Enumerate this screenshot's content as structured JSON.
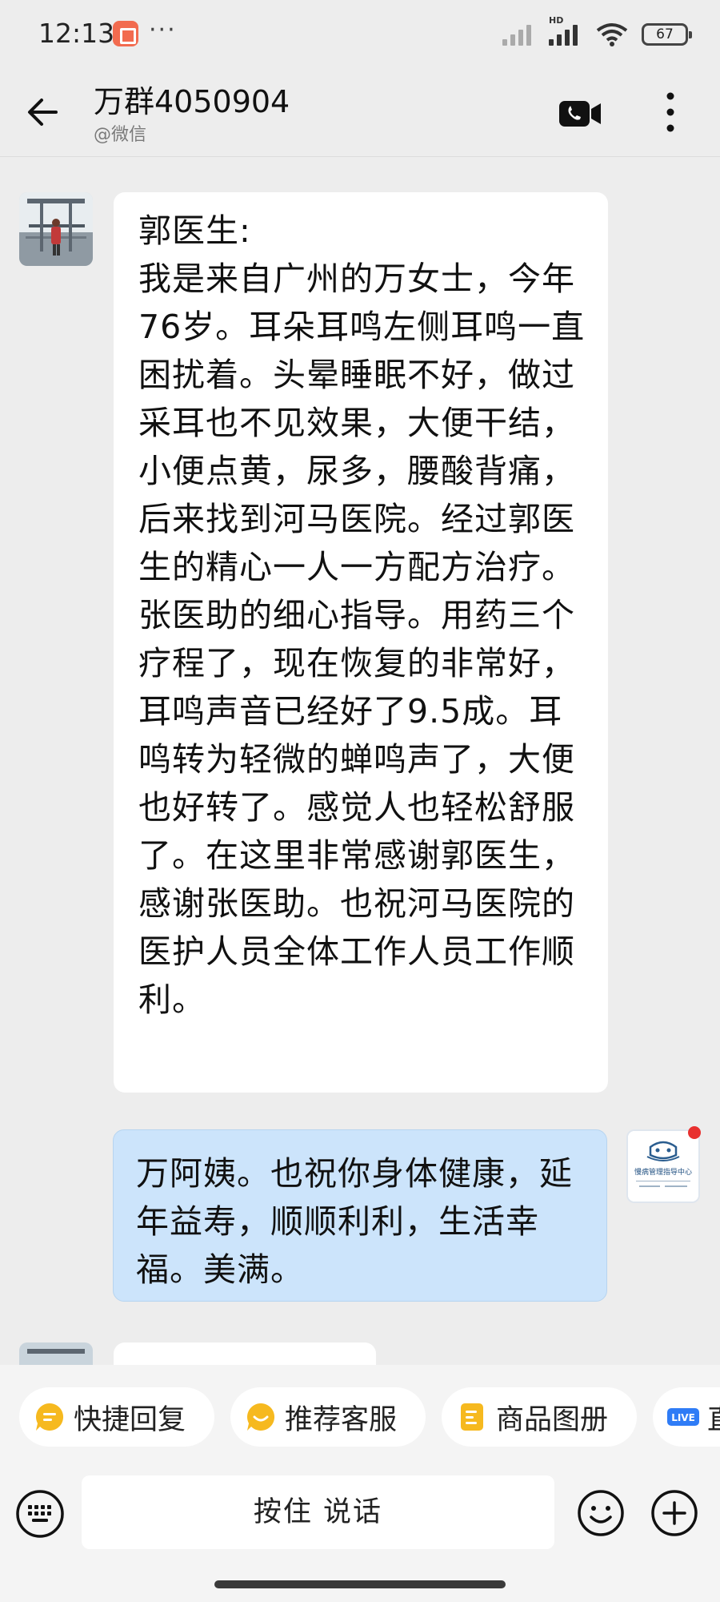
{
  "status_bar": {
    "time": "12:13",
    "more": "···",
    "network_label": "HD",
    "battery": "67",
    "notification_color": "#f26b4f"
  },
  "header": {
    "title": "万群4050904",
    "subtitle": "@微信"
  },
  "messages": [
    {
      "side": "left",
      "text": "郭医生:\n我是来自广州的万女士，今年76岁。耳朵耳鸣左侧耳鸣一直困扰着。头晕睡眠不好，做过采耳也不见效果，大便干结，小便点黄，尿多，腰酸背痛，后来找到河马医院。经过郭医生的精心一人一方配方治疗。张医助的细心指导。用药三个疗程了，现在恢复的非常好，耳鸣声音已经好了9.5成。耳鸣转为轻微的蝉鸣声了，大便也好转了。感觉人也轻松舒服了。在这里非常感谢郭医生，感谢张医助。也祝河马医院的医护人员全体工作人员工作顺利。",
      "bubble_color": "#ffffff"
    },
    {
      "side": "right",
      "text": "万阿姨。也祝你身体健康，延年益寿，顺顺利利，生活幸福。美满。",
      "bubble_color": "#cce4fb",
      "avatar_label": "慢病管理指导中心",
      "avatar_tiny_label": "慢病管理指导中心"
    }
  ],
  "quick_replies": [
    {
      "label": "快捷回复",
      "icon": "quick-reply-icon",
      "color": "#f6b91f"
    },
    {
      "label": "推荐客服",
      "icon": "recommend-service-icon",
      "color": "#f6b91f"
    },
    {
      "label": "商品图册",
      "icon": "product-album-icon",
      "color": "#f6b91f"
    },
    {
      "label": "直",
      "icon": "live-icon",
      "badge": "LIVE",
      "color": "#2f7cf6"
    }
  ],
  "input": {
    "voice_label": "按住 说话"
  }
}
